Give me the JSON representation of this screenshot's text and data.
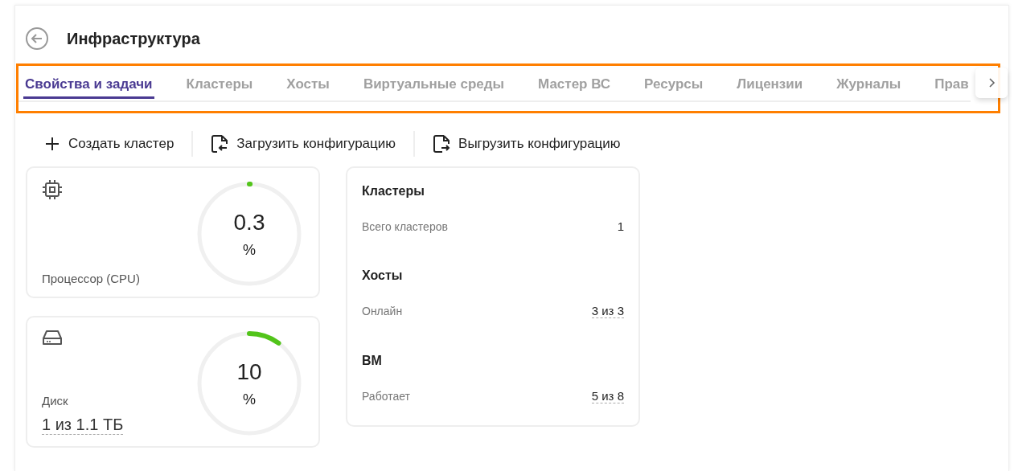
{
  "header": {
    "title": "Инфраструктура"
  },
  "tabs": [
    {
      "label": "Свойства и задачи",
      "selected": true
    },
    {
      "label": "Кластеры",
      "selected": false
    },
    {
      "label": "Хосты",
      "selected": false
    },
    {
      "label": "Виртуальные среды",
      "selected": false
    },
    {
      "label": "Мастер ВС",
      "selected": false
    },
    {
      "label": "Ресурсы",
      "selected": false
    },
    {
      "label": "Лицензии",
      "selected": false
    },
    {
      "label": "Журналы",
      "selected": false
    },
    {
      "label": "Прав",
      "selected": false
    }
  ],
  "toolbar": [
    {
      "kind": "create",
      "label": "Создать кластер"
    },
    {
      "kind": "upload",
      "label": "Загрузить конфигурацию"
    },
    {
      "kind": "download",
      "label": "Выгрузить конфигурацию"
    }
  ],
  "gauges": [
    {
      "kind": "cpu",
      "label": "Процессор (CPU)",
      "value": "0.3",
      "unit": "%",
      "level": 0.003
    },
    {
      "kind": "disk",
      "label": "Диск",
      "detail": "1 из 1.1 ТБ",
      "value": "10",
      "unit": "%",
      "level": 0.1
    }
  ],
  "summary": [
    {
      "title": "Кластеры",
      "label": "Всего кластеров",
      "value": "1",
      "link": false
    },
    {
      "title": "Хосты",
      "label": "Онлайн",
      "value": "3 из 3",
      "link": true
    },
    {
      "title": "ВМ",
      "label": "Работает",
      "value": "5 из 8",
      "link": true
    }
  ]
}
